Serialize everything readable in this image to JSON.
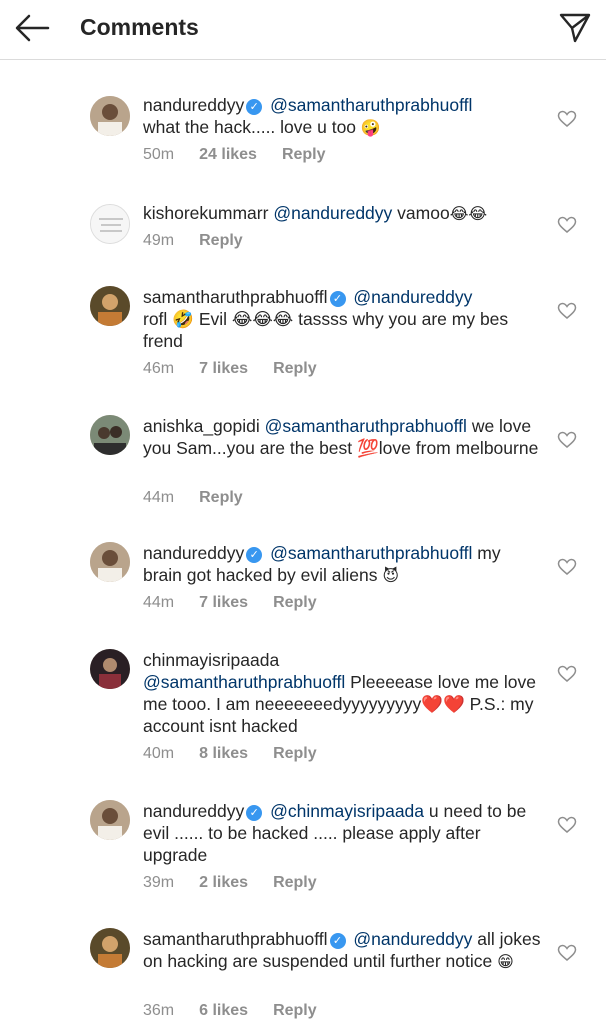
{
  "header": {
    "title": "Comments"
  },
  "icons": {
    "back": "arrow-left-icon",
    "share": "paper-plane-icon",
    "like": "heart-outline-icon",
    "verified": "verified-badge-icon"
  },
  "colors": {
    "mention": "#003569",
    "meta": "#8e8e8e",
    "verified": "#3897f0",
    "text": "#262626"
  },
  "comments": [
    {
      "username": "nandureddyy",
      "verified": true,
      "mention": "@samantharuthprabhuoffl",
      "text": "what the hack..... love u too",
      "emoji": "🤪",
      "time": "50m",
      "likes": "24 likes",
      "reply": "Reply"
    },
    {
      "username": "kishorekummarr",
      "verified": false,
      "mention": "@nandureddyy",
      "text": "vamoo",
      "emoji": "😂😂",
      "time": "49m",
      "likes": "",
      "reply": "Reply"
    },
    {
      "username": "samantharuthprabhuoffl",
      "verified": true,
      "mention": "@nandureddyy",
      "text": "rofl 🤣 Evil 😂😂😂 tassss why you are my bes frend",
      "emoji": "",
      "time": "46m",
      "likes": "7 likes",
      "reply": "Reply"
    },
    {
      "username": "anishka_gopidi",
      "verified": false,
      "mention": "@samantharuthprabhuoffl",
      "text": "we love you Sam...you are the best 💯love from melbourne",
      "emoji": "",
      "time": "44m",
      "likes": "",
      "reply": "Reply"
    },
    {
      "username": "nandureddyy",
      "verified": true,
      "mention": "@samantharuthprabhuoffl",
      "text": "my brain got hacked by evil aliens",
      "emoji": "😈",
      "time": "44m",
      "likes": "7 likes",
      "reply": "Reply"
    },
    {
      "username": "chinmayisripaada",
      "verified": false,
      "mention": "@samantharuthprabhuoffl",
      "text": "Pleeeease love me love me tooo. I am neeeeeeedyyyyyyyyy❤️❤️ P.S.: my account isnt hacked",
      "emoji": "",
      "time": "40m",
      "likes": "8 likes",
      "reply": "Reply"
    },
    {
      "username": "nandureddyy",
      "verified": true,
      "mention": "@chinmayisripaada",
      "text": "u need to be evil ...... to be hacked ..... please apply after upgrade",
      "emoji": "",
      "time": "39m",
      "likes": "2 likes",
      "reply": "Reply"
    },
    {
      "username": "samantharuthprabhuoffl",
      "verified": true,
      "mention": "@nandureddyy",
      "text": "all jokes on hacking are suspended until further notice",
      "emoji": "😁",
      "time": "36m",
      "likes": "6 likes",
      "reply": "Reply"
    }
  ]
}
